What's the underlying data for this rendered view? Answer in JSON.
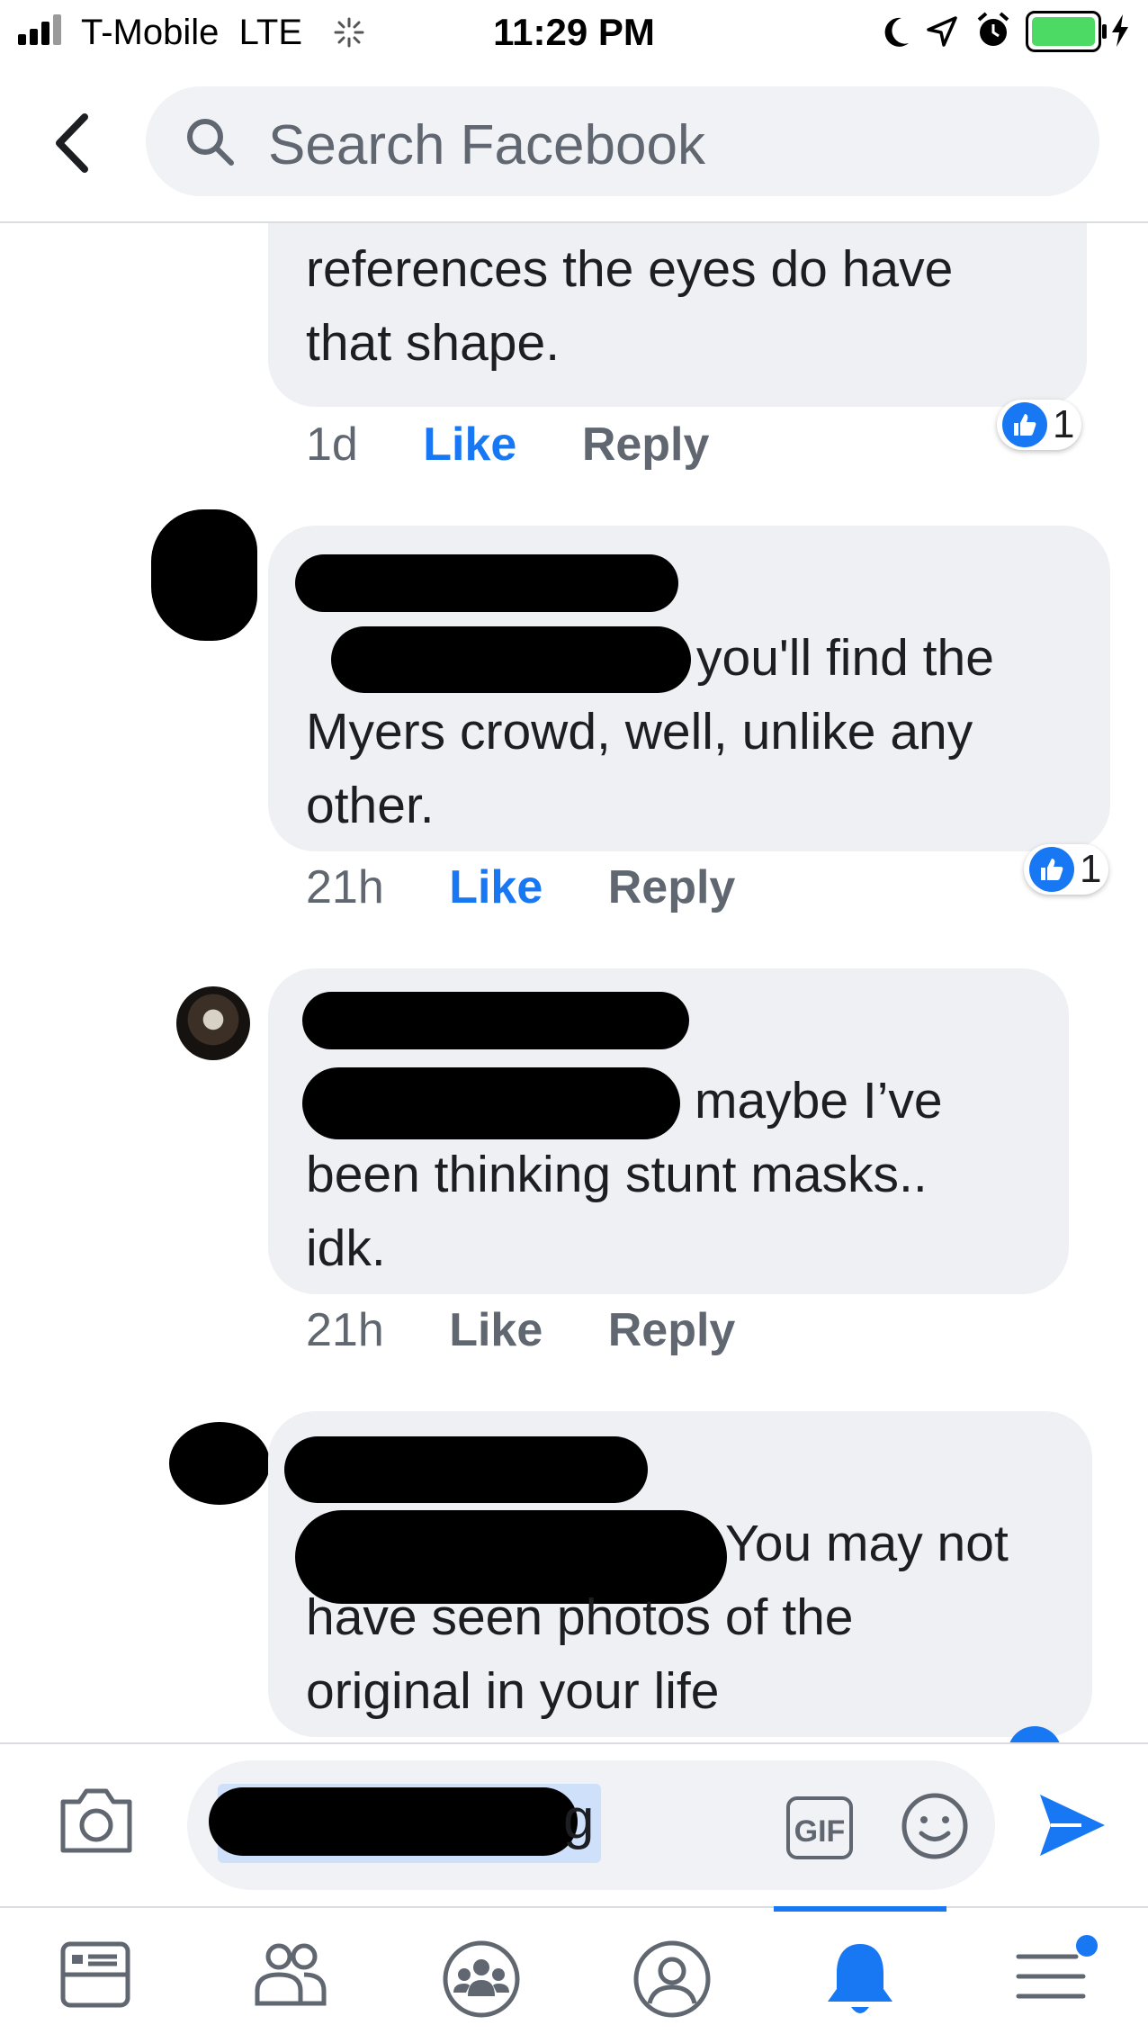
{
  "status_bar": {
    "carrier": "T-Mobile",
    "network": "LTE",
    "time": "11:29 PM",
    "icons": [
      "signal-bars-icon",
      "loading-spinner-icon",
      "moon-icon",
      "location-arrow-icon",
      "alarm-clock-icon",
      "battery-icon",
      "charging-bolt-icon"
    ]
  },
  "header": {
    "search_placeholder": "Search Facebook",
    "back_icon": "chevron-left-icon",
    "search_icon": "search-icon"
  },
  "comments": [
    {
      "text_lines": [
        "references the eyes do have",
        "that shape."
      ],
      "time": "1d",
      "like_label": "Like",
      "reply_label": "Reply",
      "liked": true,
      "reaction_count": "1"
    },
    {
      "text_lines": [
        "you'll find the",
        "Myers crowd, well, unlike any",
        "other."
      ],
      "time": "21h",
      "like_label": "Like",
      "reply_label": "Reply",
      "liked": true,
      "reaction_count": "1"
    },
    {
      "text_lines": [
        "maybe I’ve",
        "been thinking stunt masks..",
        "idk."
      ],
      "time": "21h",
      "like_label": "Like",
      "reply_label": "Reply",
      "liked": false
    },
    {
      "text_lines": [
        "You may not",
        "have seen photos of the",
        "original in your life"
      ]
    }
  ],
  "composer": {
    "text_tail": "g",
    "camera_icon": "camera-icon",
    "gif_label": "GIF",
    "emoji_icon": "smiley-icon",
    "send_icon": "send-arrow-icon"
  },
  "tabbar": {
    "tabs": [
      "news-feed-icon",
      "friends-icon",
      "groups-icon",
      "profile-icon",
      "notifications-bell-icon",
      "menu-icon"
    ],
    "active_tab": "notifications-bell-icon",
    "accent_color": "#1877f2"
  }
}
